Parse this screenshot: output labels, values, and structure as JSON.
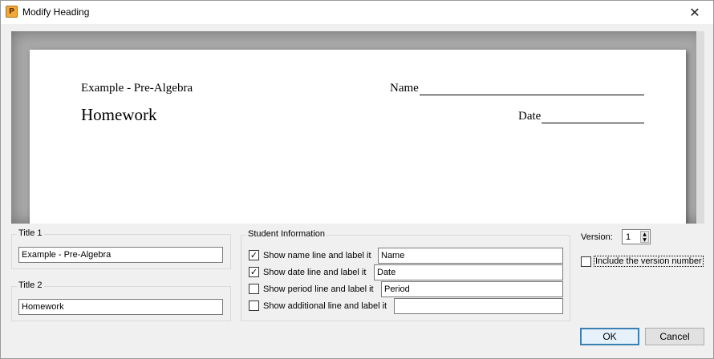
{
  "window": {
    "title": "Modify Heading",
    "app_icon_glyph": "P",
    "close_glyph": "✕"
  },
  "preview": {
    "title1": "Example - Pre-Algebra",
    "title2": "Homework",
    "name_label": "Name",
    "date_label": "Date"
  },
  "title1_group": {
    "label": "Title 1",
    "value": "Example - Pre-Algebra"
  },
  "title2_group": {
    "label": "Title 2",
    "value": "Homework"
  },
  "student_info": {
    "label": "Student Information",
    "rows": [
      {
        "label": "Show name line and label it",
        "checked": true,
        "value": "Name"
      },
      {
        "label": "Show date line and label it",
        "checked": true,
        "value": "Date"
      },
      {
        "label": "Show period line and label it",
        "checked": false,
        "value": "Period"
      },
      {
        "label": "Show additional line and label it",
        "checked": false,
        "value": ""
      }
    ]
  },
  "version": {
    "label": "Version:",
    "value": "1",
    "include_label": "Include the version number",
    "include_checked": false
  },
  "buttons": {
    "ok": "OK",
    "cancel": "Cancel"
  },
  "icons": {
    "check": "✓",
    "spin_up": "▲",
    "spin_down": "▼"
  }
}
